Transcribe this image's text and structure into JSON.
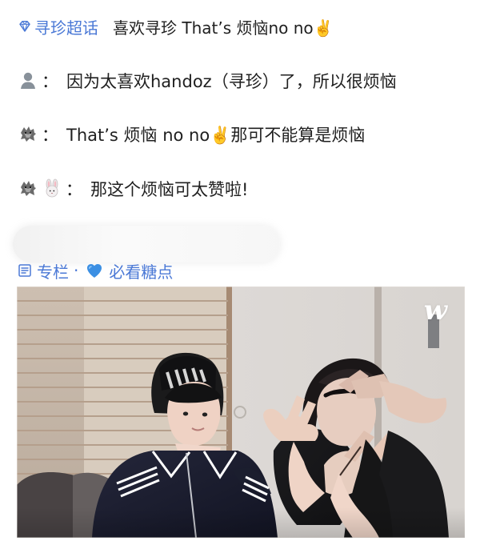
{
  "topic": {
    "tag": "寻珍超话",
    "title": "喜欢寻珍 That’s 烦恼no no✌️"
  },
  "lines": [
    {
      "speaker_icon": "person-icon",
      "text": "因为太喜欢handoz（寻珍）了，所以很烦恼"
    },
    {
      "speaker_icon": "wolf-icon",
      "text": "That’s 烦恼 no no✌️那可不能算是烦恼"
    },
    {
      "speaker_icon_1": "wolf-icon",
      "speaker_icon_2": "rabbit-icon",
      "text": "那这个烦恼可太赞啦!"
    }
  ],
  "column": {
    "label": "专栏",
    "separator": "·",
    "subtitle": "必看糖点"
  },
  "media": {
    "watermark": "w"
  }
}
